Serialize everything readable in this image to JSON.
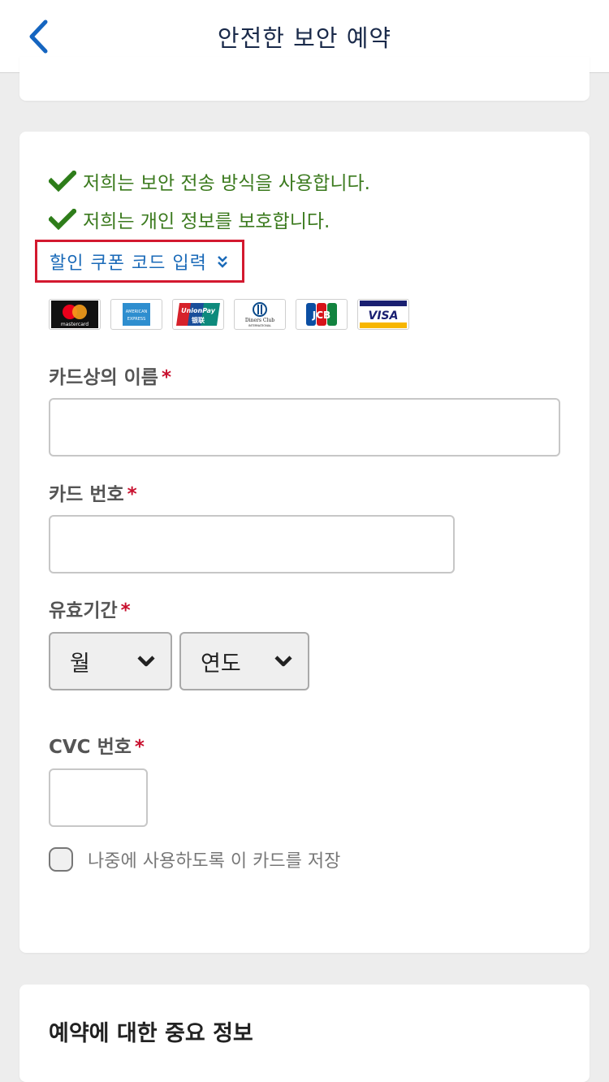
{
  "header": {
    "title": "안전한 보안 예약",
    "back_icon": "chevron-left-icon",
    "accent_color": "#1565c0"
  },
  "security": {
    "items": [
      {
        "icon": "checkmark-icon",
        "text": "저희는 보안 전송 방식을 사용합니다."
      },
      {
        "icon": "checkmark-icon",
        "text": "저희는 개인 정보를 보호합니다."
      }
    ],
    "color": "#3b7a1e"
  },
  "coupon": {
    "label": "할인 쿠폰 코드 입력",
    "icon": "double-chevron-down-icon"
  },
  "card_logos": {
    "mastercard": "mastercard",
    "amex_top": "AMERICAN",
    "amex_bottom": "EXPRESS",
    "unionpay_top": "UnionPay",
    "unionpay_bottom": "银联",
    "diners_top": "Diners Club",
    "diners_bottom": "INTERNATIONAL",
    "jcb": "JCB",
    "visa": "VISA"
  },
  "form": {
    "required_mark": "*",
    "name_label": "카드상의 이름",
    "name_value": "",
    "card_number_label": "카드 번호",
    "card_number_value": "",
    "expiry_label": "유효기간",
    "month_selected": "월",
    "year_selected": "연도",
    "cvc_label": "CVC 번호",
    "cvc_value": "",
    "save_card_label": "나중에 사용하도록 이 카드를 저장",
    "save_card_checked": false
  },
  "important": {
    "title": "예약에 대한 중요 정보"
  }
}
